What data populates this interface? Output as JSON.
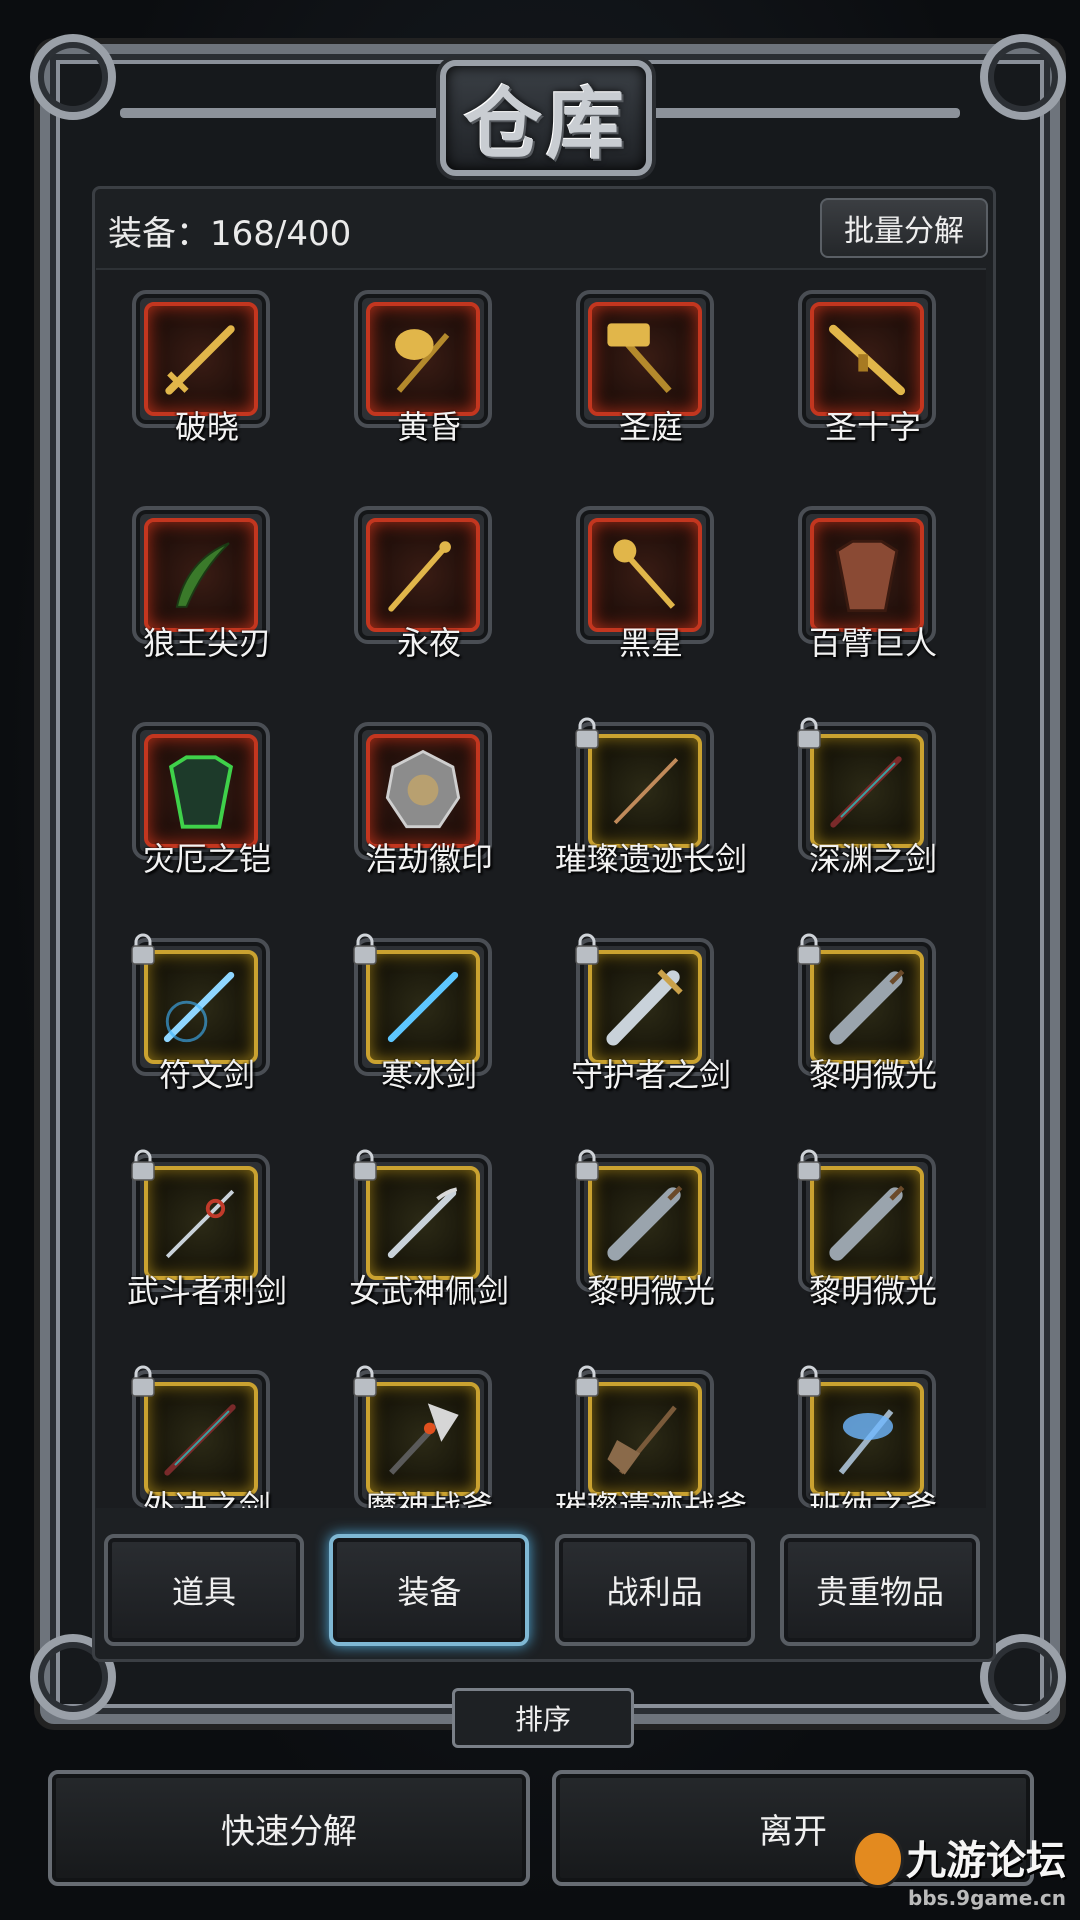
{
  "title": "仓库",
  "capacity_label": "装备：168/400",
  "batch_button": "批量分解",
  "items": [
    {
      "name": "破晓",
      "frame": "red",
      "icon": "golden-sword-icon",
      "locked": false
    },
    {
      "name": "黄昏",
      "frame": "red",
      "icon": "golden-axe-icon",
      "locked": false
    },
    {
      "name": "圣庭",
      "frame": "red",
      "icon": "golden-hammer-icon",
      "locked": false
    },
    {
      "name": "圣十字",
      "frame": "red",
      "icon": "golden-gun-icon",
      "locked": false
    },
    {
      "name": "狼王尖刃",
      "frame": "red",
      "icon": "curved-blade-icon",
      "locked": false
    },
    {
      "name": "永夜",
      "frame": "red",
      "icon": "dagger-icon",
      "locked": false
    },
    {
      "name": "黑星",
      "frame": "red",
      "icon": "mace-icon",
      "locked": false
    },
    {
      "name": "百臂巨人",
      "frame": "red",
      "icon": "armor-icon",
      "locked": false
    },
    {
      "name": "灾厄之铠",
      "frame": "red",
      "icon": "green-armor-icon",
      "locked": false
    },
    {
      "name": "浩劫徽印",
      "frame": "red",
      "icon": "emblem-icon",
      "locked": false
    },
    {
      "name": "璀璨遗迹长剑",
      "frame": "gold",
      "icon": "long-sword-icon",
      "locked": true
    },
    {
      "name": "深渊之剑",
      "frame": "gold",
      "icon": "dark-sword-icon",
      "locked": true
    },
    {
      "name": "符文剑",
      "frame": "gold",
      "icon": "rune-sword-icon",
      "locked": true
    },
    {
      "name": "寒冰剑",
      "frame": "gold",
      "icon": "ice-sword-icon",
      "locked": true
    },
    {
      "name": "守护者之剑",
      "frame": "gold",
      "icon": "broad-sword-icon",
      "locked": true
    },
    {
      "name": "黎明微光",
      "frame": "gold",
      "icon": "cleaver-sword-icon",
      "locked": true
    },
    {
      "name": "武斗者刺剑",
      "frame": "gold",
      "icon": "rapier-icon",
      "locked": true
    },
    {
      "name": "女武神佩剑",
      "frame": "gold",
      "icon": "valkyrie-sword-icon",
      "locked": true
    },
    {
      "name": "黎明微光",
      "frame": "gold",
      "icon": "cleaver-sword-icon",
      "locked": true
    },
    {
      "name": "黎明微光",
      "frame": "gold",
      "icon": "cleaver-sword-icon",
      "locked": true
    },
    {
      "name": "外决之剑",
      "frame": "gold",
      "icon": "dark-sword-icon",
      "locked": true
    },
    {
      "name": "魔神战斧",
      "frame": "gold",
      "icon": "demon-axe-icon",
      "locked": true
    },
    {
      "name": "璀璨遗迹战斧",
      "frame": "gold",
      "icon": "war-axe-icon",
      "locked": true
    },
    {
      "name": "班纳之斧",
      "frame": "gold",
      "icon": "blue-axe-icon",
      "locked": true
    }
  ],
  "tabs": [
    {
      "label": "道具",
      "active": false
    },
    {
      "label": "装备",
      "active": true
    },
    {
      "label": "战利品",
      "active": false
    },
    {
      "label": "贵重物品",
      "active": false
    }
  ],
  "sort_button": "排序",
  "quick_decompose_button": "快速分解",
  "leave_button": "离开",
  "watermark": {
    "title": "九游论坛",
    "url": "bbs.9game.cn"
  },
  "colors": {
    "red_frame": "#c3361f",
    "gold_frame": "#caa230",
    "active_tab_glow": "#4fa7d6"
  }
}
